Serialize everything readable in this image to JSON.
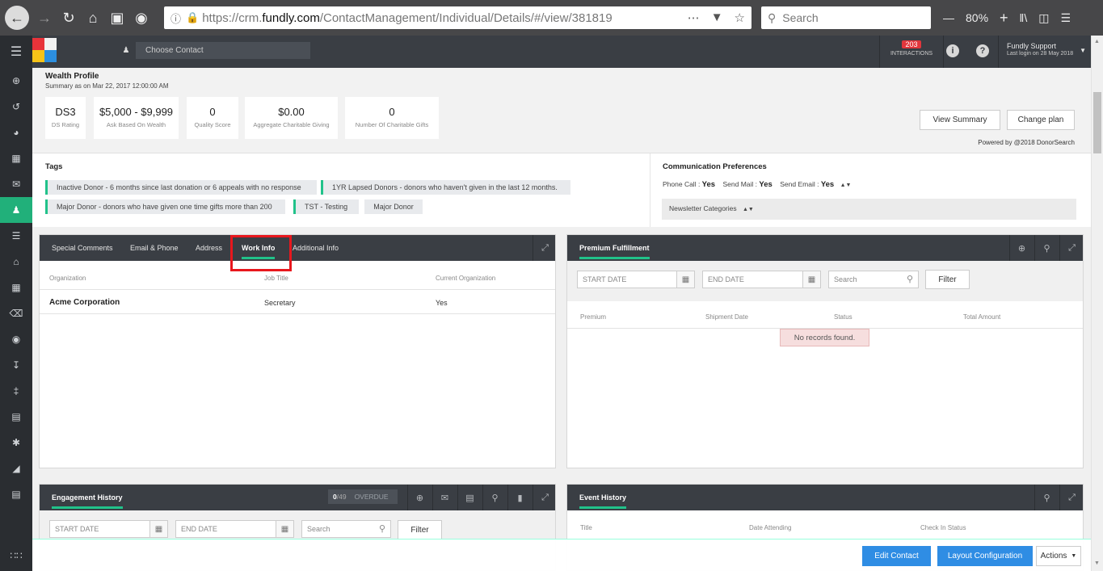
{
  "browser": {
    "url_prefix": "https://crm.",
    "url_domain": "fundly.com",
    "url_path": "/ContactManagement/Individual/Details/#/view/381819",
    "search_placeholder": "Search",
    "zoom": "80%"
  },
  "header": {
    "choose_contact_placeholder": "Choose Contact",
    "interactions_count": "203",
    "interactions_label": "INTERACTIONS",
    "user_name": "Fundly Support",
    "last_login": "Last login on 28 May 2018"
  },
  "wealth": {
    "title": "Wealth Profile",
    "summary": "Summary as on Mar 22, 2017 12:00:00 AM",
    "stats": [
      {
        "value": "DS3",
        "caption": "DS Rating"
      },
      {
        "value": "$5,000 - $9,999",
        "caption": "Ask Based On Wealth"
      },
      {
        "value": "0",
        "caption": "Quality Score"
      },
      {
        "value": "$0.00",
        "caption": "Aggregate Charitable Giving"
      },
      {
        "value": "0",
        "caption": "Number Of Charitable Gifts"
      }
    ],
    "view_summary": "View Summary",
    "change_plan": "Change plan",
    "powered_by": "Powered by @2018 DonorSearch"
  },
  "tags": {
    "title": "Tags",
    "items": [
      "Inactive Donor - 6 months since last donation or 6 appeals with no response",
      "1YR Lapsed Donors - donors who haven't given in the last 12 months.",
      "Major Donor - donors who have given one time gifts more than 200",
      "TST - Testing",
      "Major Donor"
    ]
  },
  "communication": {
    "title": "Communication Preferences",
    "phone_label": "Phone Call : ",
    "phone_value": "Yes",
    "mail_label": "Send Mail : ",
    "mail_value": "Yes",
    "email_label": "Send Email : ",
    "email_value": "Yes",
    "newsletter": "Newsletter Categories"
  },
  "info_panel": {
    "tabs": [
      "Special Comments",
      "Email & Phone",
      "Address",
      "Work Info",
      "Additional Info"
    ],
    "active_tab": "Work Info",
    "columns": [
      "Organization",
      "Job Title",
      "Current Organization"
    ],
    "rows": [
      [
        "Acme Corporation",
        "Secretary",
        "Yes"
      ]
    ]
  },
  "premium_panel": {
    "title": "Premium Fulfillment",
    "start_date": "START DATE",
    "end_date": "END DATE",
    "search": "Search",
    "filter": "Filter",
    "columns": [
      "Premium",
      "Shipment Date",
      "Status",
      "Total Amount"
    ],
    "empty": "No records found."
  },
  "engagement_panel": {
    "title": "Engagement History",
    "count": "0",
    "total": "/49",
    "overdue": "OVERDUE",
    "start_date": "START DATE",
    "end_date": "END DATE",
    "search": "Search",
    "filter": "Filter"
  },
  "event_panel": {
    "title": "Event History",
    "columns": [
      "Title",
      "Date Attending",
      "Check In Status"
    ]
  },
  "footer": {
    "edit_contact": "Edit Contact",
    "layout_configuration": "Layout Configuration",
    "actions": "Actions"
  },
  "colors": {
    "accent_green": "#21c28a",
    "header_dark": "#3a3e44",
    "primary_blue": "#2f8de4",
    "highlight_red": "#e8171d"
  }
}
